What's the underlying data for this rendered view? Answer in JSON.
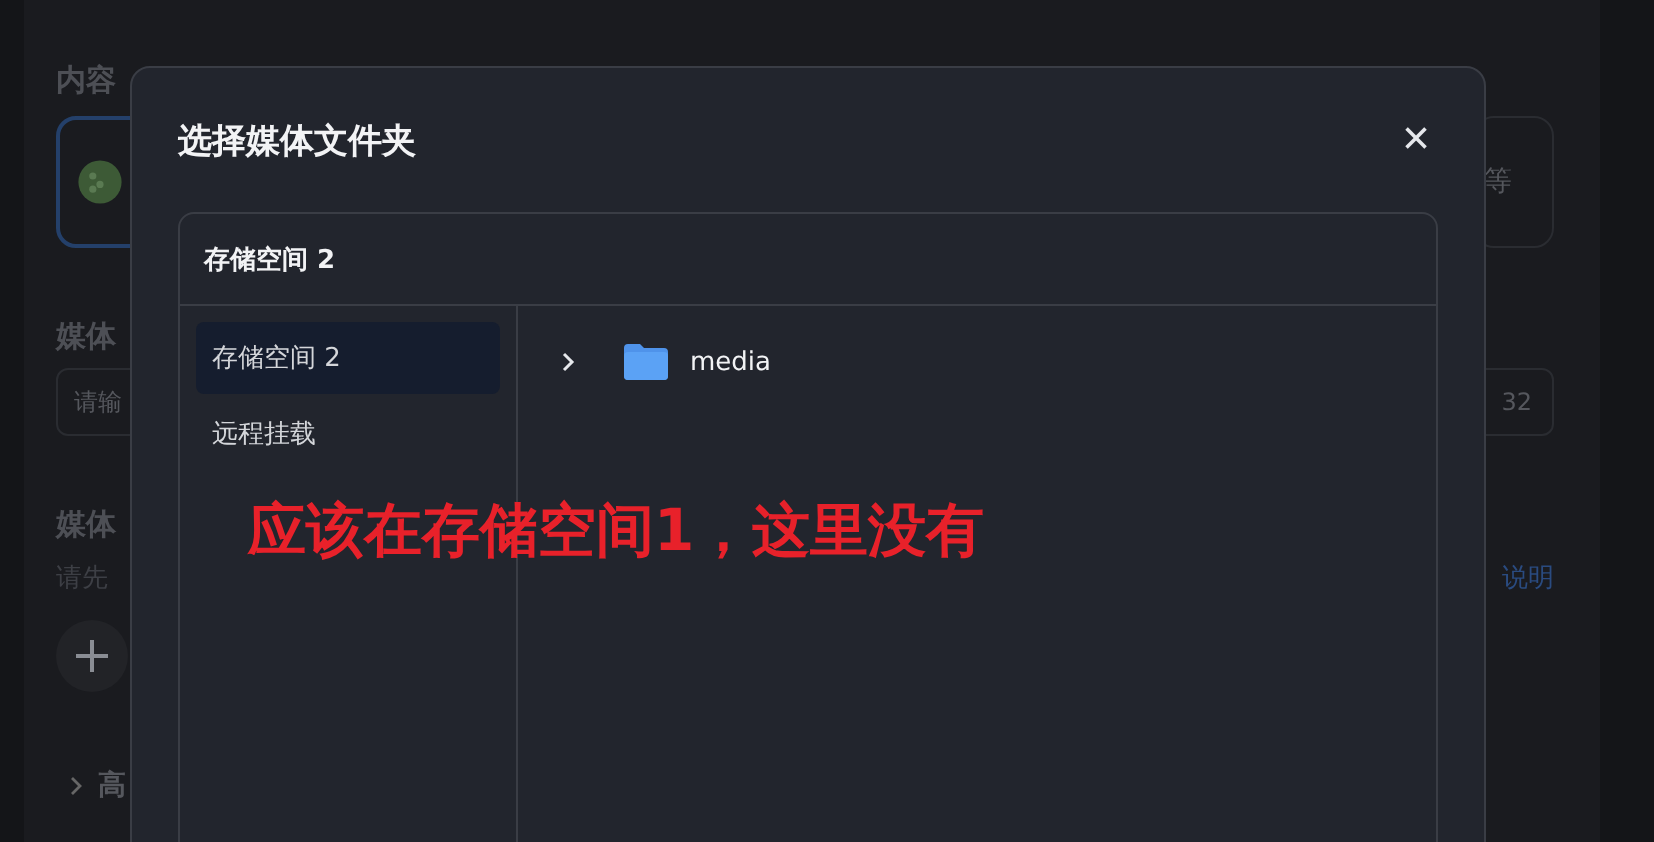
{
  "background": {
    "section_1_label": "内容",
    "content_card_right_text": "等",
    "section_2_label": "媒体",
    "input_placeholder": "请输",
    "input_right_text": "32",
    "section_3_label": "媒体",
    "hint": "请先",
    "hint_link": "说明",
    "advanced_label": "高"
  },
  "dialog": {
    "title": "选择媒体文件夹",
    "close": "×",
    "panel_title": "存储空间 2",
    "locations": [
      {
        "label": "存储空间 2",
        "selected": true
      },
      {
        "label": "远程挂载",
        "selected": false
      }
    ],
    "folders": [
      {
        "name": "media",
        "expanded": false
      }
    ]
  },
  "annotation": "应该在存储空间1，这里没有"
}
